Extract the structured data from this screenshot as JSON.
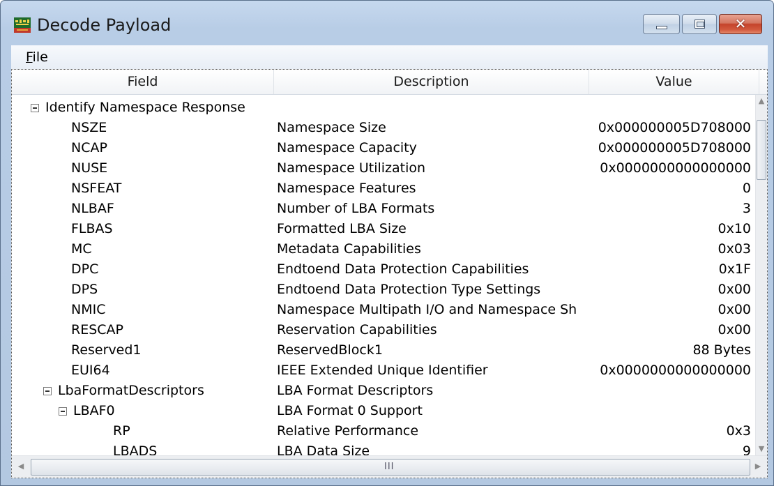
{
  "window": {
    "title": "Decode Payload",
    "minimize_icon": "minimize-icon",
    "maximize_icon": "maximize-icon",
    "close_icon": "close-icon",
    "close_glyph": "✕"
  },
  "menu": {
    "file_label_first": "F",
    "file_label_rest": "ile"
  },
  "columns": {
    "field": "Field",
    "description": "Description",
    "value": "Value"
  },
  "rows": [
    {
      "field": "Identify Namespace Response",
      "description": "",
      "value": "",
      "expander": true,
      "level": 0
    },
    {
      "field": "NSZE",
      "description": "Namespace Size",
      "value": "0x000000005D708000",
      "level": 1
    },
    {
      "field": "NCAP",
      "description": "Namespace Capacity",
      "value": "0x000000005D708000",
      "level": 1
    },
    {
      "field": "NUSE",
      "description": "Namespace Utilization",
      "value": "0x0000000000000000",
      "level": 1
    },
    {
      "field": "NSFEAT",
      "description": "Namespace Features",
      "value": "0",
      "level": 1
    },
    {
      "field": "NLBAF",
      "description": "Number of LBA Formats",
      "value": "3",
      "level": 1
    },
    {
      "field": "FLBAS",
      "description": "Formatted LBA Size",
      "value": "0x10",
      "level": 1
    },
    {
      "field": "MC",
      "description": "Metadata Capabilities",
      "value": "0x03",
      "level": 1
    },
    {
      "field": "DPC",
      "description": "Endtoend Data Protection Capabilities",
      "value": "0x1F",
      "level": 1
    },
    {
      "field": "DPS",
      "description": "Endtoend Data Protection Type Settings",
      "value": "0x00",
      "level": 1
    },
    {
      "field": "NMIC",
      "description": "Namespace Multipath I/O and Namespace Sh",
      "value": "0x00",
      "level": 1
    },
    {
      "field": "RESCAP",
      "description": "Reservation Capabilities",
      "value": "0x00",
      "level": 1
    },
    {
      "field": "Reserved1",
      "description": "ReservedBlock1",
      "value": "88 Bytes",
      "level": 1
    },
    {
      "field": "EUI64",
      "description": "IEEE Extended Unique Identifier",
      "value": "0x0000000000000000",
      "level": 1
    },
    {
      "field": "LbaFormatDescriptors",
      "description": "LBA Format Descriptors",
      "value": "",
      "expander": true,
      "level": 2
    },
    {
      "field": "LBAF0",
      "description": "LBA Format 0 Support",
      "value": "",
      "expander": true,
      "level": 3
    },
    {
      "field": "RP",
      "description": "Relative Performance",
      "value": "0x3",
      "level": 4
    },
    {
      "field": "LBADS",
      "description": "LBA Data Size",
      "value": "9",
      "level": 4
    }
  ],
  "scrollbar": {
    "grip": "III"
  }
}
